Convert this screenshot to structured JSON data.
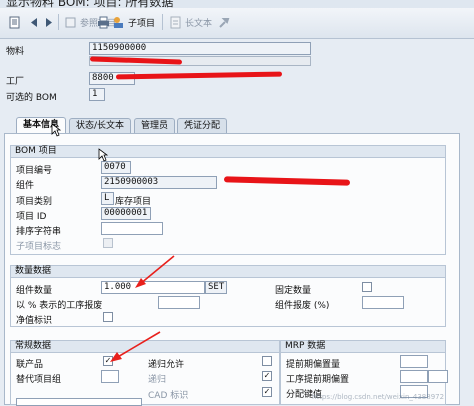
{
  "window": {
    "title": "显示物料 BOM: 项目: 所有数据"
  },
  "toolbar": {
    "items": [
      {
        "label": "",
        "icon": "document-icon",
        "enabled": true
      },
      {
        "label": "",
        "icon": "arrow-left-icon",
        "enabled": true
      },
      {
        "label": "",
        "icon": "arrow-right-icon",
        "enabled": true
      },
      {
        "label": "参照项目",
        "icon": "reference-icon",
        "enabled": false
      },
      {
        "label": "",
        "icon": "print-icon",
        "enabled": true
      },
      {
        "label": "子项目",
        "icon": "subitem-icon",
        "enabled": true
      },
      {
        "label": "长文本",
        "icon": "longtext-icon",
        "enabled": false
      },
      {
        "label": "",
        "icon": "wrench-icon",
        "enabled": false
      }
    ]
  },
  "header": {
    "material_label": "物料",
    "material_value": "1150900000",
    "plant_label": "工厂",
    "plant_value": "8800",
    "alt_bom_label": "可选的 BOM",
    "alt_bom_value": "1"
  },
  "tabs": [
    {
      "label": "基本信息",
      "active": true
    },
    {
      "label": "状态/长文本",
      "active": false
    },
    {
      "label": "管理员",
      "active": false
    },
    {
      "label": "凭证分配",
      "active": false
    }
  ],
  "bom_item": {
    "group_title": "BOM 项目",
    "item_no_label": "项目编号",
    "item_no_value": "0070",
    "component_label": "组件",
    "component_value": "2150900003",
    "item_cat_label": "项目类别",
    "item_cat_code": "L",
    "item_cat_text": "库存项目",
    "item_id_label": "项目 ID",
    "item_id_value": "00000001",
    "sort_label": "排序字符串",
    "sort_value": "",
    "subitem_flag_label": "子项目标志"
  },
  "quantity": {
    "group_title": "数量数据",
    "comp_qty_label": "组件数量",
    "comp_qty_value": "1.000",
    "comp_qty_unit": "SET",
    "fixed_qty_label": "固定数量",
    "scrap_pct_label": "以 % 表示的工序报废",
    "comp_scrap_label": "组件报废 (%)",
    "net_label": "净值标识"
  },
  "general": {
    "group_title": "常规数据",
    "coproduct_label": "联产品",
    "coproduct_checked": true,
    "alt_group_label": "替代项目组",
    "alt_group_value": "",
    "recursive_label": "递归允许",
    "recursive_checked": false,
    "recursive2_label": "递归",
    "recursive2_checked": true,
    "cad_label": "CAD 标识",
    "cad_checked": true
  },
  "mrp": {
    "group_title": "MRP 数据",
    "lead_offset_label": "提前期偏置量",
    "op_lead_label": "工序提前期偏置",
    "dist_key_label": "分配键值"
  },
  "watermark": "https://blog.csdn.net/weixin_4388972"
}
